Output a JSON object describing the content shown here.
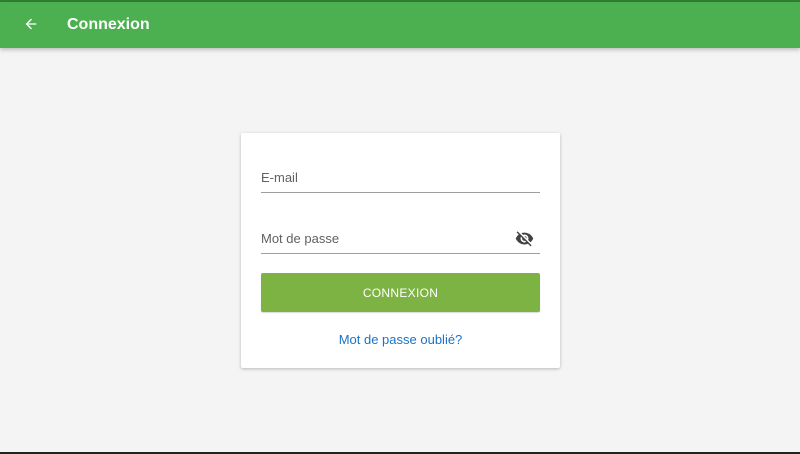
{
  "app_bar": {
    "title": "Connexion",
    "back_icon": "arrow-left-icon",
    "color": "#4caf50"
  },
  "login_form": {
    "email": {
      "placeholder": "E-mail",
      "value": ""
    },
    "password": {
      "placeholder": "Mot de passe",
      "value": "",
      "visibility_icon": "eye-off-icon"
    },
    "submit_label": "CONNEXION",
    "submit_color": "#7cb342",
    "forgot_password_label": "Mot de passe oublié?",
    "link_color": "#1a73c7"
  }
}
